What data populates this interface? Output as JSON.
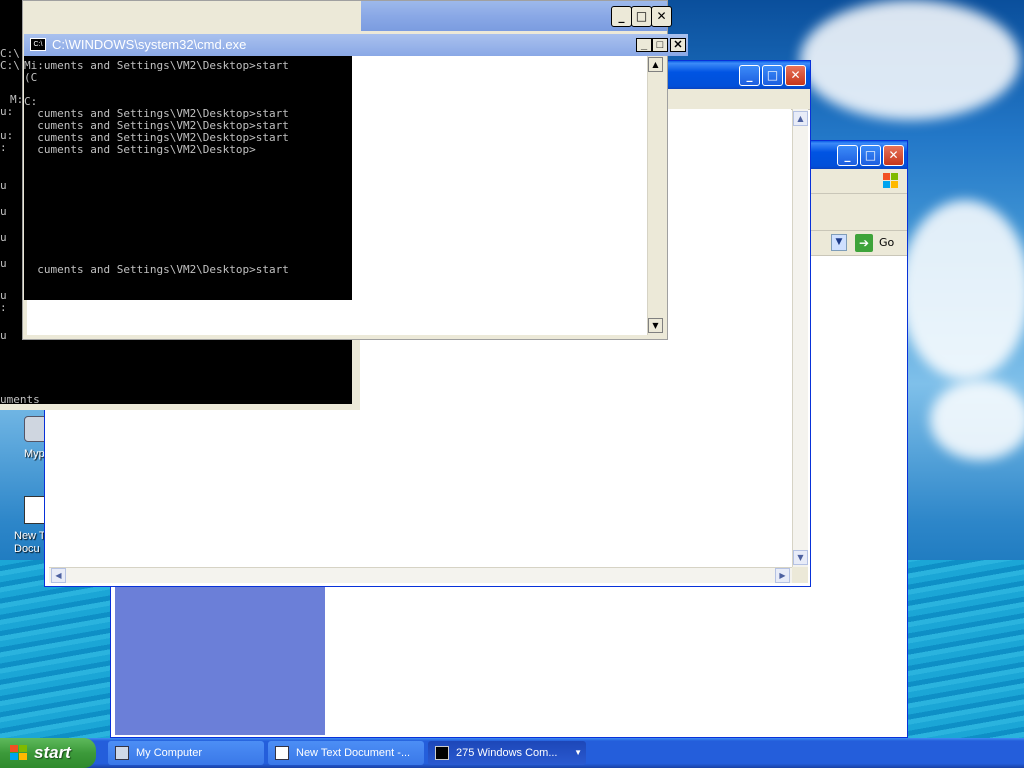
{
  "desktop": {
    "icons": [
      {
        "label": "Myp"
      },
      {
        "label": "New T"
      },
      {
        "label": "Docu"
      }
    ]
  },
  "back_console": {
    "lines": [
      "C:\\",
      "C:\\",
      "",
      "M:",
      "u:",
      "",
      "u:",
      ":",
      "",
      "",
      "u",
      "",
      "u",
      "",
      "u",
      "",
      "u",
      "",
      "",
      "u",
      ":",
      "",
      "u"
    ],
    "bottom_text": "uments"
  },
  "cmd_window": {
    "title": "C:\\WINDOWS\\system32\\cmd.exe",
    "icon": "console-icon",
    "lines": [
      "Mi:uments and Settings\\VM2\\Desktop>start",
      "(C",
      "",
      "C:",
      "  cuments and Settings\\VM2\\Desktop>start",
      "  cuments and Settings\\VM2\\Desktop>start",
      "  cuments and Settings\\VM2\\Desktop>start",
      "  cuments and Settings\\VM2\\Desktop>",
      "",
      "",
      "",
      "",
      "",
      "",
      "",
      "",
      "",
      "",
      "  cuments and Settings\\VM2\\Desktop>start"
    ]
  },
  "explorer_window": {
    "go_label": "Go"
  },
  "taskbar": {
    "start_label": "start",
    "items": [
      {
        "label": "My Computer",
        "icon": "computer-icon"
      },
      {
        "label": "New Text Document -...",
        "icon": "notepad-icon"
      },
      {
        "label": "275 Windows Com...",
        "icon": "console-icon"
      }
    ]
  },
  "colors": {
    "xp_blue": "#0054e3",
    "taskbar": "#245edb",
    "start_green": "#3c9a3a"
  }
}
